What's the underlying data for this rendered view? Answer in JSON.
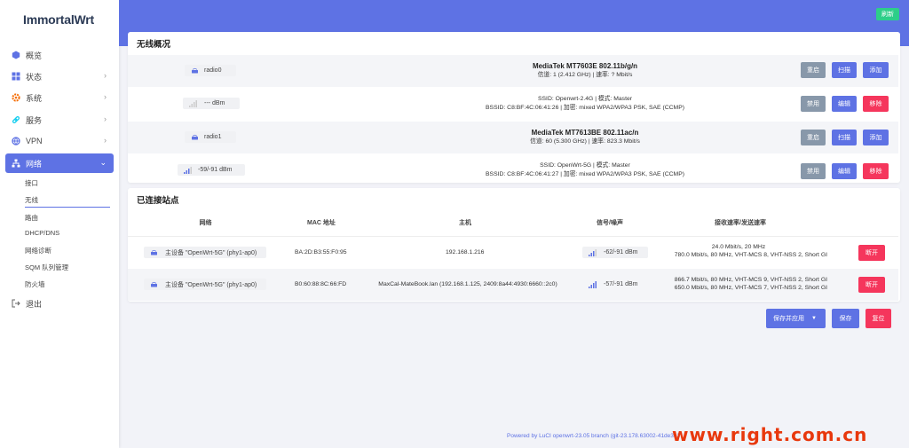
{
  "sidebar": {
    "logo": "ImmortalWrt",
    "items": [
      {
        "label": "概览"
      },
      {
        "label": "状态"
      },
      {
        "label": "系统"
      },
      {
        "label": "服务"
      },
      {
        "label": "VPN"
      },
      {
        "label": "网络"
      }
    ],
    "sub_items": [
      {
        "label": "接口"
      },
      {
        "label": "无线"
      },
      {
        "label": "路由"
      },
      {
        "label": "DHCP/DNS"
      },
      {
        "label": "网络诊断"
      },
      {
        "label": "SQM 队列管理"
      },
      {
        "label": "防火墙"
      }
    ],
    "logout": "退出"
  },
  "topbar": {
    "refresh": "刷新"
  },
  "wireless": {
    "title": "无线概况",
    "radios": [
      {
        "name": "radio0",
        "device": "MediaTek MT7603E 802.11b/g/n",
        "info": "信道: 1 (2.412 GHz) | 速率: ? Mbit/s",
        "btn_restart": "重启",
        "btn_scan": "扫描",
        "btn_add": "添加",
        "net": {
          "signal": "--- dBm",
          "ssid_line": "SSID: Openwrt-2.4G | 模式: Master",
          "bssid_line": "BSSID: C8:BF:4C:06:41:26 | 加密: mixed WPA2/WPA3 PSK, SAE (CCMP)",
          "btn_disable": "禁用",
          "btn_edit": "编辑",
          "btn_remove": "移除"
        }
      },
      {
        "name": "radio1",
        "device": "MediaTek MT7613BE 802.11ac/n",
        "info": "信道: 60 (5.300 GHz) | 速率: 823.3 Mbit/s",
        "btn_restart": "重启",
        "btn_scan": "扫描",
        "btn_add": "添加",
        "net": {
          "signal": "-59/-91 dBm",
          "ssid_line": "SSID: OpenWrt-5G | 模式: Master",
          "bssid_line": "BSSID: C8:BF:4C:06:41:27 | 加密: mixed WPA2/WPA3 PSK, SAE (CCMP)",
          "btn_disable": "禁用",
          "btn_edit": "编辑",
          "btn_remove": "移除"
        }
      }
    ]
  },
  "stations": {
    "title": "已连接站点",
    "headers": [
      "网络",
      "MAC 地址",
      "主机",
      "信号/噪声",
      "接收速率/发送速率"
    ],
    "rows": [
      {
        "network": "主设备 \"OpenWrt-5G\" (phy1-ap0)",
        "mac": "BA:2D:B3:55:F0:95",
        "host": "192.168.1.216",
        "signal": "-62/-91 dBm",
        "rate1": "24.0 Mbit/s, 20 MHz",
        "rate2": "780.0 Mbit/s, 80 MHz, VHT-MCS 8, VHT-NSS 2, Short GI",
        "btn": "断开"
      },
      {
        "network": "主设备 \"OpenWrt-5G\" (phy1-ap0)",
        "mac": "B0:60:88:8C:66:FD",
        "host": "MaxCal-MateBook.lan (192.168.1.125, 2409:8a44:4930:6660::2c0)",
        "signal": "-57/-91 dBm",
        "rate1": "866.7 Mbit/s, 80 MHz, VHT-MCS 9, VHT-NSS 2, Short GI",
        "rate2": "650.0 Mbit/s, 80 MHz, VHT-MCS 7, VHT-NSS 2, Short GI",
        "btn": "断开"
      }
    ]
  },
  "actions": {
    "save_apply": "保存并应用",
    "save": "保存",
    "reset": "复位"
  },
  "footer": "Powered by LuCI openwrt-23.05 branch (git-23.178.63002-41de3e3",
  "watermark": "www.right.com.cn",
  "colors": {
    "primary": "#5e72e4",
    "danger": "#f5365c",
    "success": "#2dce89",
    "gray": "#8898aa"
  }
}
